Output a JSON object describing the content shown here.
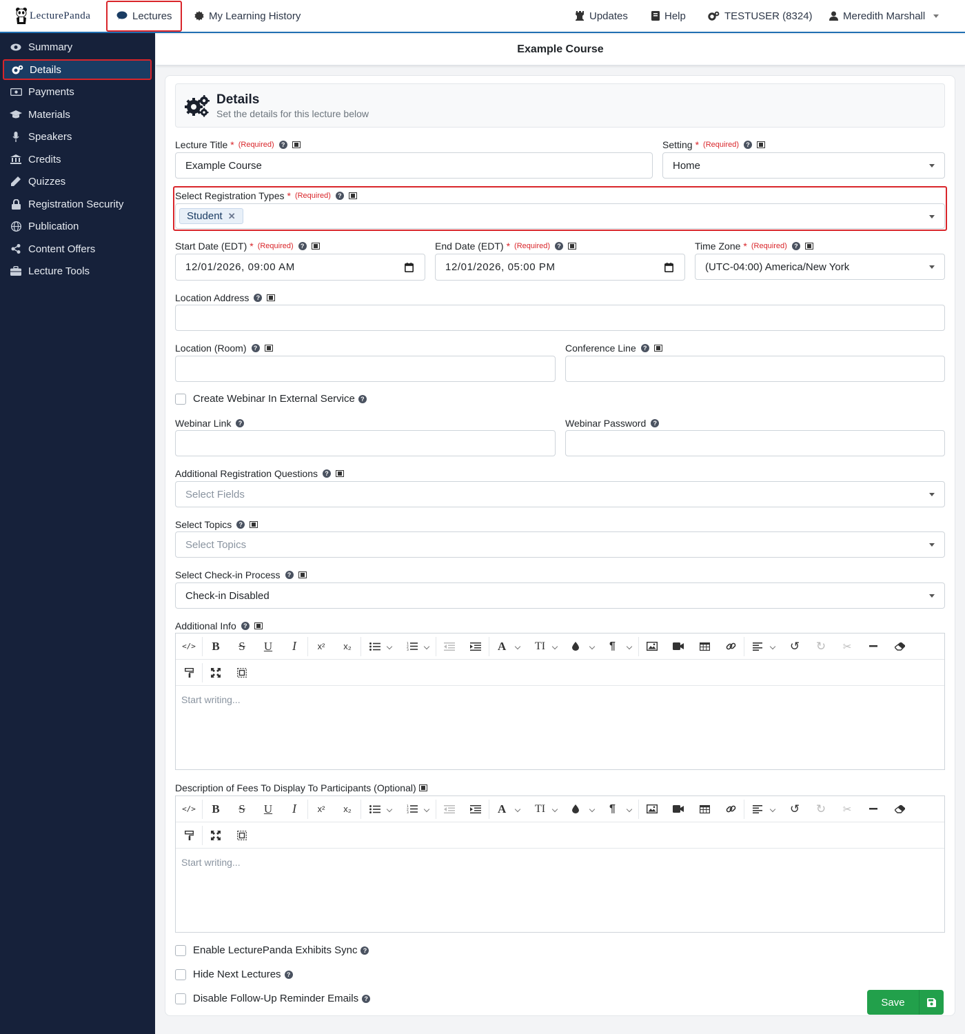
{
  "app": {
    "logo_text": "LecturePanda"
  },
  "topnav": {
    "lectures": "Lectures",
    "history": "My Learning History",
    "updates": "Updates",
    "help": "Help",
    "account": "TESTUSER (8324)",
    "user": "Meredith Marshall"
  },
  "sidebar": {
    "items": [
      {
        "label": "Summary",
        "icon": "eye-icon"
      },
      {
        "label": "Details",
        "icon": "gears-icon"
      },
      {
        "label": "Payments",
        "icon": "money-icon"
      },
      {
        "label": "Materials",
        "icon": "graduation-cap-icon"
      },
      {
        "label": "Speakers",
        "icon": "microphone-icon"
      },
      {
        "label": "Credits",
        "icon": "bank-icon"
      },
      {
        "label": "Quizzes",
        "icon": "pencil-icon"
      },
      {
        "label": "Registration Security",
        "icon": "lock-icon"
      },
      {
        "label": "Publication",
        "icon": "globe-icon"
      },
      {
        "label": "Content Offers",
        "icon": "share-icon"
      },
      {
        "label": "Lecture Tools",
        "icon": "toolbox-icon"
      }
    ]
  },
  "header": {
    "title": "Example Course"
  },
  "intro": {
    "title": "Details",
    "subtitle": "Set the details for this lecture below"
  },
  "required_text": "(Required)",
  "form": {
    "lecture_title": {
      "label": "Lecture Title",
      "value": "Example Course"
    },
    "setting": {
      "label": "Setting",
      "value": "Home"
    },
    "registration_types": {
      "label": "Select Registration Types",
      "chips": [
        "Student"
      ]
    },
    "start_date": {
      "label": "Start Date (EDT)",
      "value": "12/01/2026, 09:00 AM"
    },
    "end_date": {
      "label": "End Date (EDT)",
      "value": "12/01/2026, 05:00 PM"
    },
    "time_zone": {
      "label": "Time Zone",
      "value": "(UTC-04:00) America/New York"
    },
    "location_address": {
      "label": "Location Address",
      "value": ""
    },
    "location_room": {
      "label": "Location (Room)",
      "value": ""
    },
    "conference_line": {
      "label": "Conference Line",
      "value": ""
    },
    "create_webinar": {
      "label": "Create Webinar In External Service",
      "checked": false
    },
    "webinar_link": {
      "label": "Webinar Link",
      "value": ""
    },
    "webinar_password": {
      "label": "Webinar Password",
      "value": ""
    },
    "additional_questions": {
      "label": "Additional Registration Questions",
      "placeholder": "Select Fields"
    },
    "topics": {
      "label": "Select Topics",
      "placeholder": "Select Topics"
    },
    "checkin": {
      "label": "Select Check-in Process",
      "value": "Check-in Disabled"
    },
    "additional_info": {
      "label": "Additional Info",
      "placeholder": "Start writing..."
    },
    "fees_description": {
      "label": "Description of Fees To Display To Participants (Optional)",
      "placeholder": "Start writing..."
    },
    "exhibits_sync": {
      "label": "Enable LecturePanda Exhibits Sync",
      "checked": false
    },
    "hide_next": {
      "label": "Hide Next Lectures",
      "checked": false
    },
    "disable_followup": {
      "label": "Disable Follow-Up Reminder Emails",
      "checked": false
    }
  },
  "save_label": "Save"
}
